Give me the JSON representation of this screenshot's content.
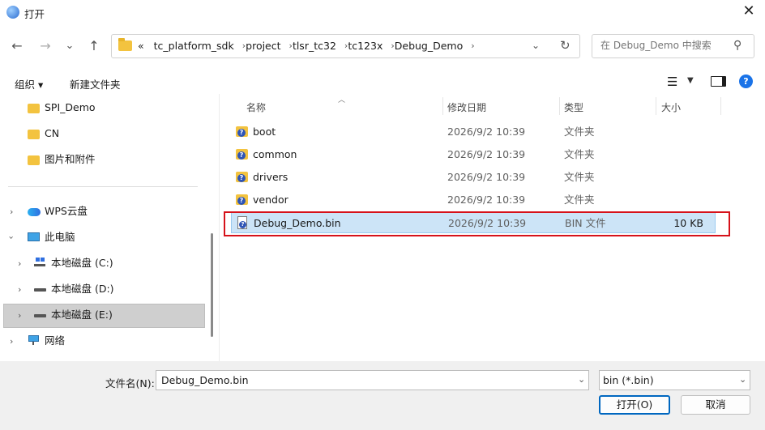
{
  "window": {
    "title": "打开",
    "close_glyph": "✕"
  },
  "nav": {
    "back": "←",
    "forward": "→",
    "recent": "⌄",
    "up": "↑",
    "breadcrumbs": [
      "«",
      "tc_platform_sdk",
      "project",
      "tlsr_tc32",
      "tc123x",
      "Debug_Demo"
    ],
    "search_placeholder": "在 Debug_Demo 中搜索"
  },
  "toolbar": {
    "organize": "组织 ▾",
    "new_folder": "新建文件夹"
  },
  "sidebar": {
    "items": [
      {
        "label": "SPI_Demo"
      },
      {
        "label": "CN"
      },
      {
        "label": "图片和附件"
      },
      {
        "label": "WPS云盘"
      },
      {
        "label": "此电脑"
      },
      {
        "label": "本地磁盘 (C:)"
      },
      {
        "label": "本地磁盘 (D:)"
      },
      {
        "label": "本地磁盘 (E:)"
      },
      {
        "label": "网络"
      }
    ]
  },
  "list": {
    "columns": [
      "名称",
      "修改日期",
      "类型",
      "大小"
    ],
    "rows": [
      {
        "name": "boot",
        "date": "2026/9/2 10:39",
        "type": "文件夹",
        "size": ""
      },
      {
        "name": "common",
        "date": "2026/9/2 10:39",
        "type": "文件夹",
        "size": ""
      },
      {
        "name": "drivers",
        "date": "2026/9/2 10:39",
        "type": "文件夹",
        "size": ""
      },
      {
        "name": "vendor",
        "date": "2026/9/2 10:39",
        "type": "文件夹",
        "size": ""
      },
      {
        "name": "Debug_Demo.bin",
        "date": "2026/9/2 10:39",
        "type": "BIN 文件",
        "size": "10 KB"
      }
    ]
  },
  "bottom": {
    "filename_label": "文件名(N):",
    "filename_value": "Debug_Demo.bin",
    "filetype_value": "bin (*.bin)",
    "open_label": "打开(O)",
    "cancel_label": "取消"
  },
  "colors": {
    "selection": "#cce4f7",
    "highlight_box": "#d6121a",
    "accent": "#0067c0",
    "folder": "#f3c33f"
  }
}
